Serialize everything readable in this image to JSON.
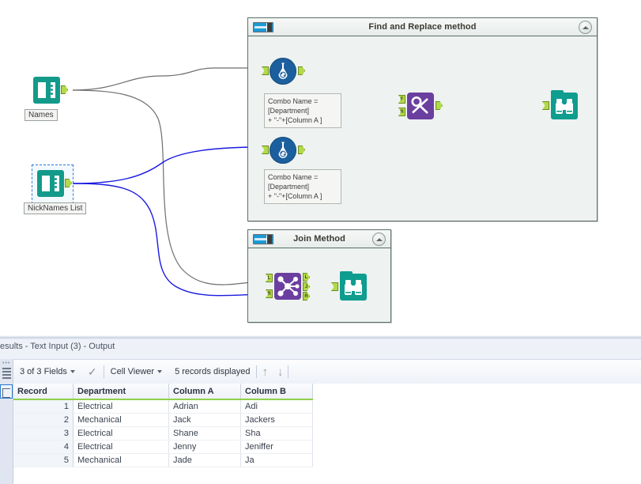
{
  "canvas": {
    "containers": [
      {
        "id": "find-replace-container",
        "title": "Find and Replace method",
        "toggle_icon": "toggle-switch-icon",
        "collapse_icon": "chevron-up-icon"
      },
      {
        "id": "join-container",
        "title": "Join Method",
        "toggle_icon": "toggle-switch-icon",
        "collapse_icon": "chevron-up-icon"
      }
    ],
    "inputs": [
      {
        "id": "names",
        "label": "Names",
        "icon": "text-input-book-icon",
        "selected": false
      },
      {
        "id": "nicknames",
        "label": "NickNames List",
        "icon": "text-input-book-icon",
        "selected": true
      }
    ],
    "annotations": [
      {
        "id": "formula-annotation-1",
        "text": "Combo Name =\n[Department]\n+ \"-\"+[Column  A ]"
      },
      {
        "id": "formula-annotation-2",
        "text": "Combo Name =\n[Department]\n+ \"-\"+[Column  A ]"
      }
    ],
    "nodes": [
      {
        "id": "formula-1",
        "icon": "formula-flask-icon",
        "in": [
          ""
        ],
        "out": [
          ""
        ]
      },
      {
        "id": "formula-2",
        "icon": "formula-flask-icon",
        "in": [
          ""
        ],
        "out": [
          ""
        ]
      },
      {
        "id": "find-replace",
        "icon": "find-replace-icon",
        "in": [
          "F",
          "R"
        ],
        "out": [
          ""
        ]
      },
      {
        "id": "browse-1",
        "icon": "browse-binoculars-icon",
        "in": [
          ""
        ],
        "out": []
      },
      {
        "id": "join",
        "icon": "join-icon",
        "in": [
          "L",
          "R"
        ],
        "out": [
          "L",
          "J",
          "R"
        ]
      },
      {
        "id": "browse-2",
        "icon": "browse-binoculars-icon",
        "in": [
          ""
        ],
        "out": []
      }
    ],
    "colors": {
      "input_tool": "#139a8a",
      "formula_tool": "#1c5f9e",
      "purple_tool": "#6b3fa0",
      "browse_tool": "#0f9d8f",
      "anchor": "#b2d94a",
      "wire_normal": "#6e6e6e",
      "wire_selected": "#1a1ae0",
      "container_border": "#5b6f66"
    }
  },
  "results": {
    "title": "esults - Text Input (3) - Output",
    "toolbar": {
      "fields_label": "3 of 3 Fields",
      "fields_caret": "chevron-down-icon",
      "check_icon": "check-icon",
      "view_label": "Cell Viewer",
      "view_caret": "chevron-down-icon",
      "records_label": "5 records displayed",
      "up_icon": "arrow-up-icon",
      "down_icon": "arrow-down-icon"
    },
    "rail": {
      "grip_icon": "grip-dots-icon",
      "list_icon": "list-view-icon",
      "data_icon": "data-hex-icon"
    },
    "table": {
      "columns": [
        "Record",
        "Department",
        "Column A",
        "Column B"
      ],
      "rows": [
        [
          "1",
          "Electrical",
          "Adrian",
          "Adi"
        ],
        [
          "2",
          "Mechanical",
          "Jack",
          "Jackers"
        ],
        [
          "3",
          "Electrical",
          "Shane",
          "Sha"
        ],
        [
          "4",
          "Electrical",
          "Jenny",
          "Jeniffer"
        ],
        [
          "5",
          "Mechanical",
          "Jade",
          "Ja"
        ]
      ]
    }
  }
}
